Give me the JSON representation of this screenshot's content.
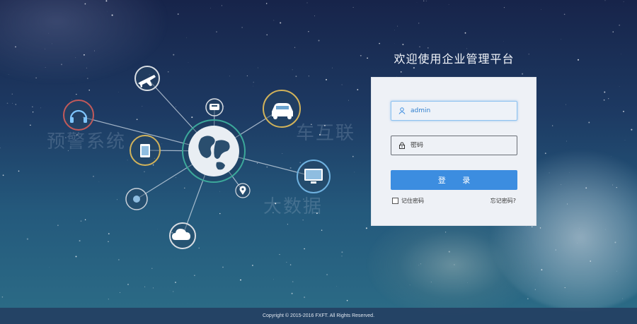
{
  "app": {
    "title": "欢迎使用企业管理平台"
  },
  "watermarks": {
    "left": "预警系统",
    "right": "车互联",
    "bottom": "大数据"
  },
  "login": {
    "username_value": "admin",
    "password_placeholder": "密码",
    "submit_label": "登 录",
    "remember_label": "记住密码",
    "forgot_label": "忘记密码?"
  },
  "footer": {
    "copyright": "Copyright © 2015-2016 FXFT. All Rights Reserved."
  },
  "colors": {
    "accent": "#3c8de0",
    "panel_bg": "#eef1f6",
    "hub_ring": "#3ca89a",
    "ring_gold": "#d2b35a",
    "ring_red": "#c25a5a",
    "ring_blue": "#6fb2e0"
  },
  "icons": {
    "hub": "globe-icon",
    "nodes": [
      "airplane-icon",
      "headphones-icon",
      "phone-icon",
      "tablet-icon",
      "car-icon",
      "monitor-icon",
      "location-pin-icon",
      "dot-icon",
      "cloud-icon"
    ],
    "user_field": "user-icon",
    "password_field": "lock-icon"
  }
}
